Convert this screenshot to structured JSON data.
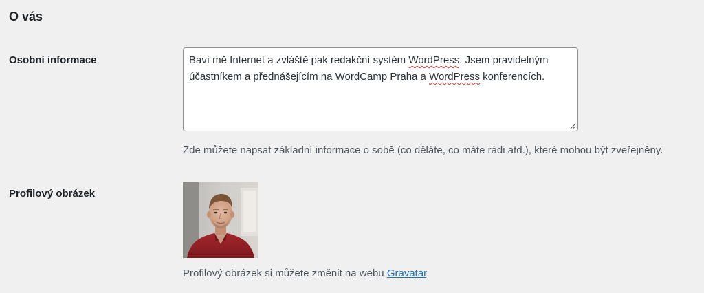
{
  "section": {
    "title": "O vás"
  },
  "bio": {
    "label": "Osobní informace",
    "text_parts": [
      "Baví mě Internet a zvláště pak redakční systém ",
      "WordPress",
      ". Jsem pravidelným účastníkem a přednášejícím na WordCamp Praha a ",
      "WordPress",
      " konferencích."
    ],
    "description": "Zde můžete napsat základní informace o sobě (co děláte, co máte rádi atd.), které mohou být zveřejněny."
  },
  "profile_picture": {
    "label": "Profilový obrázek",
    "description_prefix": "Profilový obrázek si můžete změnit na webu ",
    "link_text": "Gravatar",
    "description_suffix": "."
  },
  "colors": {
    "background": "#f0f0f1",
    "link": "#2271b1",
    "description_text": "#50575e",
    "spellcheck_underline": "#d63638"
  }
}
